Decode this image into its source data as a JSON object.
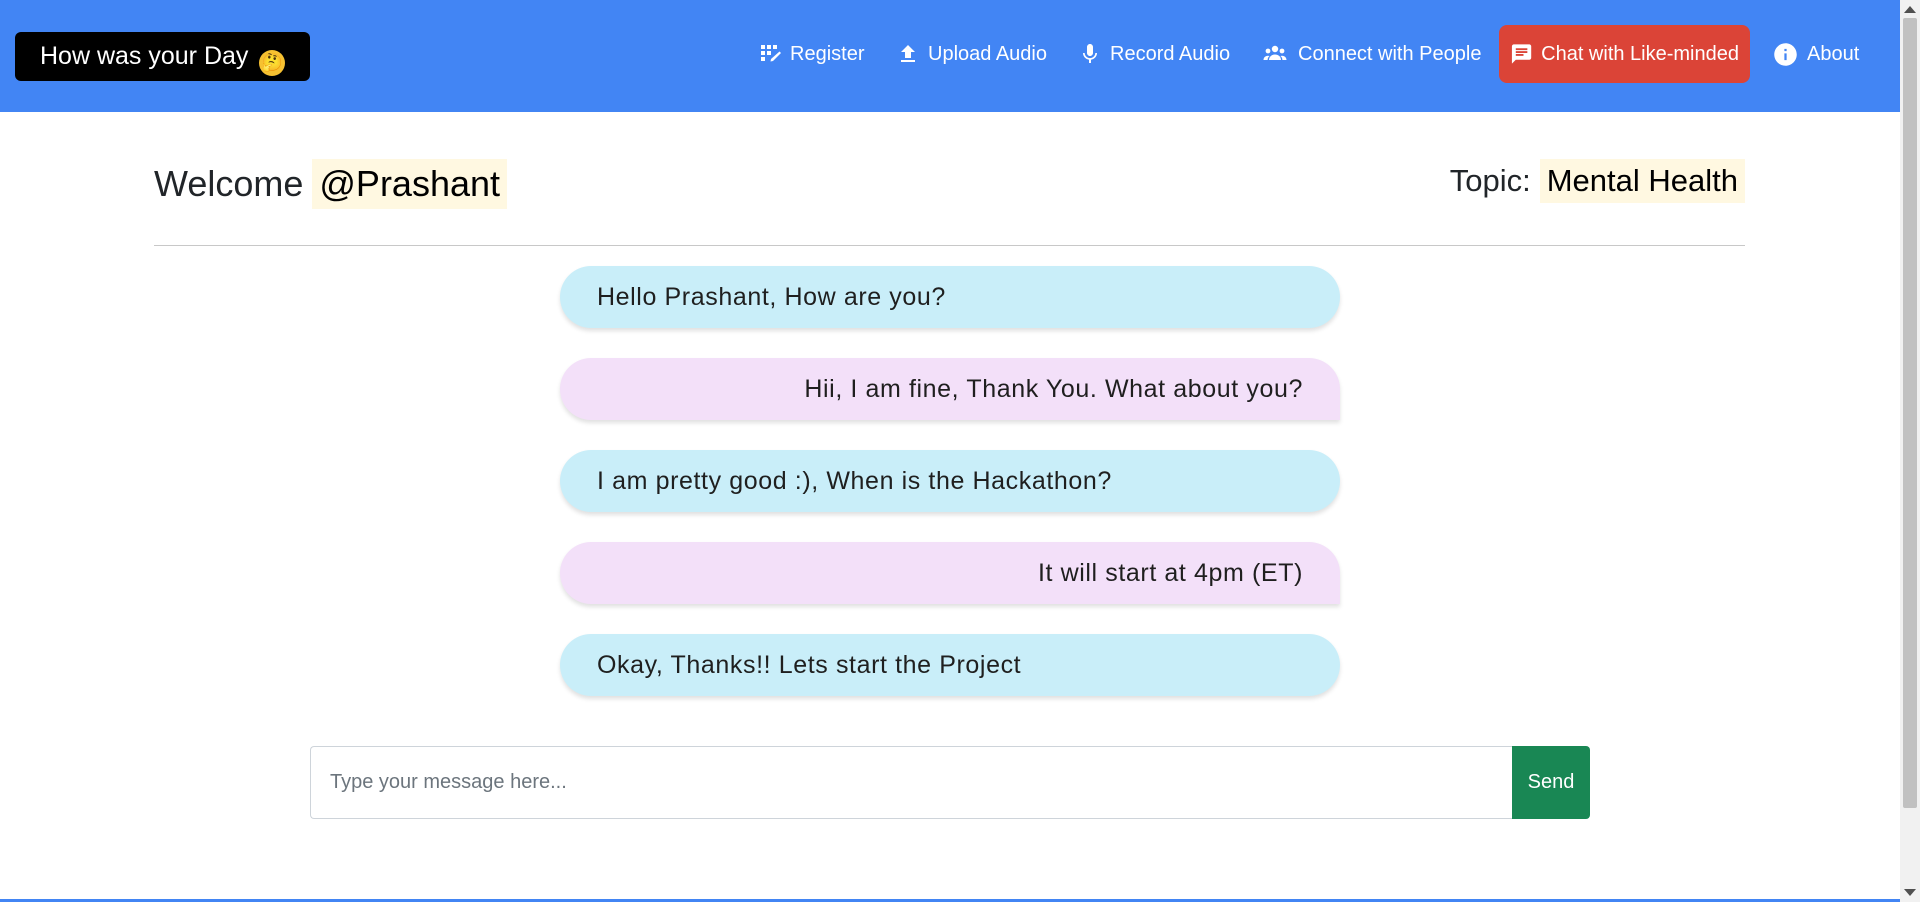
{
  "navbar": {
    "brand": "How was your Day",
    "brand_emoji": "🤔",
    "color": "#4285f4",
    "items": [
      {
        "label": "Register",
        "icon": "register-icon"
      },
      {
        "label": "Upload Audio",
        "icon": "upload-icon"
      },
      {
        "label": "Record Audio",
        "icon": "microphone-icon"
      },
      {
        "label": "Connect with People",
        "icon": "people-icon"
      },
      {
        "label": "Chat with Like-minded",
        "icon": "chat-icon",
        "active": true,
        "active_color": "#db4437"
      },
      {
        "label": "About",
        "icon": "info-icon"
      }
    ]
  },
  "header": {
    "welcome_label": "Welcome",
    "username": "@Prashant",
    "topic_label": "Topic:",
    "topic_value": "Mental Health"
  },
  "messages": [
    {
      "text": "Hello Prashant, How are you?",
      "direction": "incoming"
    },
    {
      "text": "Hii, I am fine, Thank You. What about you?",
      "direction": "outgoing"
    },
    {
      "text": "I am pretty good :), When is the Hackathon?",
      "direction": "incoming"
    },
    {
      "text": "It will start at 4pm (ET)",
      "direction": "outgoing"
    },
    {
      "text": "Okay, Thanks!! Lets start the Project",
      "direction": "incoming"
    }
  ],
  "composer": {
    "placeholder": "Type your message here...",
    "value": "",
    "send_label": "Send",
    "send_color": "#198754"
  },
  "colors": {
    "incoming_bubble": "#c9eef9",
    "outgoing_bubble": "#f3e0f9",
    "highlight": "#fff8e1"
  }
}
